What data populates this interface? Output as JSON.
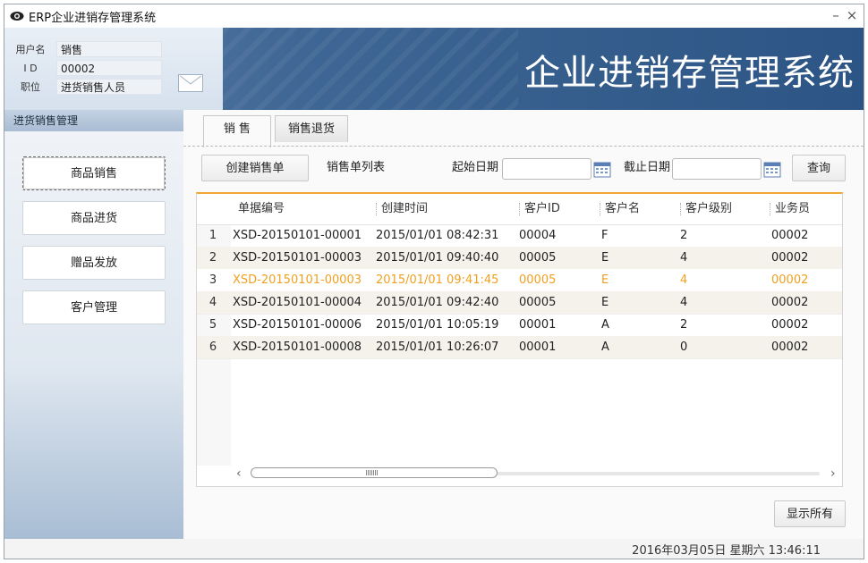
{
  "window": {
    "title": "ERP企业进销存管理系统",
    "minimize": "–",
    "close": "×"
  },
  "banner": {
    "title": "企业进销存管理系统",
    "user": [
      {
        "label": "用户名",
        "value": "销售"
      },
      {
        "label": "I D",
        "value": "00002"
      },
      {
        "label": "职位",
        "value": "进货销售人员"
      }
    ]
  },
  "sidebar": {
    "header": "进货销售管理",
    "items": [
      {
        "label": "商品销售",
        "active": true
      },
      {
        "label": "商品进货",
        "active": false
      },
      {
        "label": "赠品发放",
        "active": false
      },
      {
        "label": "客户管理",
        "active": false
      }
    ]
  },
  "tabs": [
    {
      "label": "销 售",
      "active": true
    },
    {
      "label": "销售退货",
      "active": false
    }
  ],
  "toolbar": {
    "create_button": "创建销售单",
    "list_label": "销售单列表",
    "start_date_label": "起始日期",
    "start_date_value": "",
    "end_date_label": "截止日期",
    "end_date_value": "",
    "query_button": "查询"
  },
  "table": {
    "columns": [
      "单据编号",
      "创建时间",
      "客户ID",
      "客户名",
      "客户级别",
      "业务员"
    ],
    "rows": [
      {
        "num": "1",
        "id": "XSD-20150101-00001",
        "time": "2015/01/01 08:42:31",
        "cid": "00004",
        "cname": "F",
        "level": "2",
        "staff": "00002"
      },
      {
        "num": "2",
        "id": "XSD-20150101-00003",
        "time": "2015/01/01 09:40:40",
        "cid": "00005",
        "cname": "E",
        "level": "4",
        "staff": "00002"
      },
      {
        "num": "3",
        "id": "XSD-20150101-00003",
        "time": "2015/01/01 09:41:45",
        "cid": "00005",
        "cname": "E",
        "level": "4",
        "staff": "00002"
      },
      {
        "num": "4",
        "id": "XSD-20150101-00004",
        "time": "2015/01/01 09:42:40",
        "cid": "00005",
        "cname": "E",
        "level": "4",
        "staff": "00002"
      },
      {
        "num": "5",
        "id": "XSD-20150101-00006",
        "time": "2015/01/01 10:05:19",
        "cid": "00001",
        "cname": "A",
        "level": "2",
        "staff": "00002"
      },
      {
        "num": "6",
        "id": "XSD-20150101-00008",
        "time": "2015/01/01 10:26:07",
        "cid": "00001",
        "cname": "A",
        "level": "0",
        "staff": "00002"
      }
    ],
    "highlight_row_index": 2,
    "highlight_color": "#f0a020"
  },
  "scroll": {
    "left": "‹",
    "right": "›"
  },
  "show_all_button": "显示所有",
  "status": {
    "datetime": "2016年03月05日   星期六   13:46:11"
  }
}
